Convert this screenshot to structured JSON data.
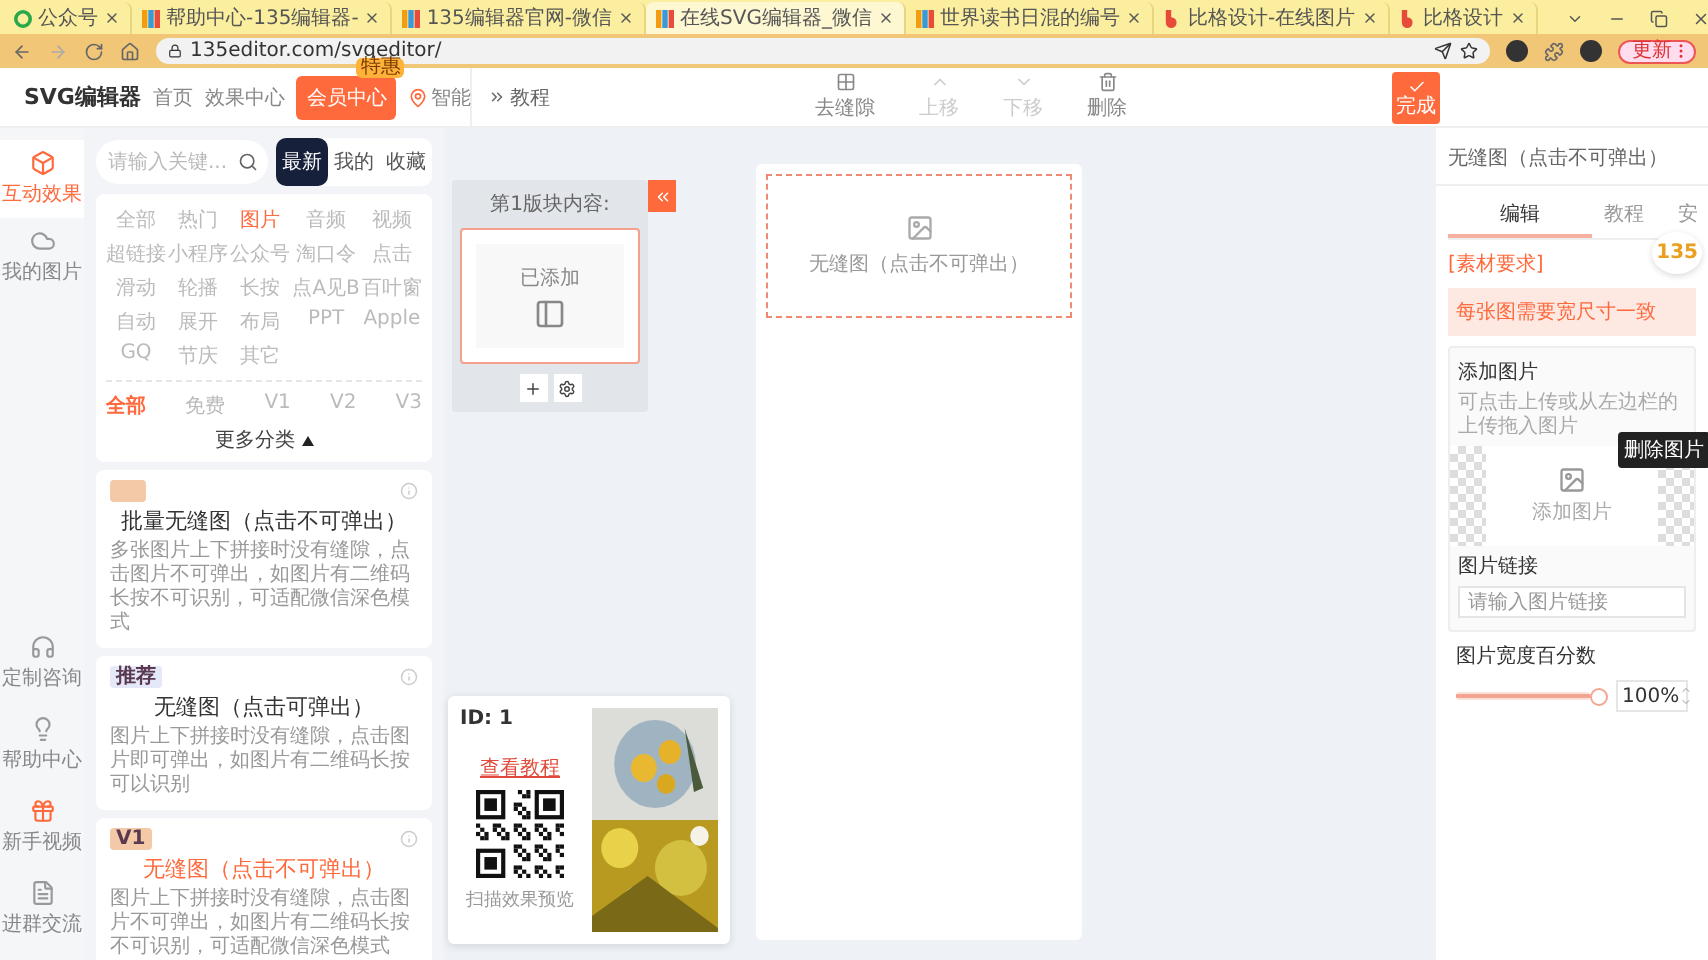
{
  "browser": {
    "tabs": [
      {
        "title": "公众号",
        "kind": "wechat",
        "selected": false
      },
      {
        "title": "帮助中心-135编辑器-",
        "kind": "editor",
        "selected": false
      },
      {
        "title": "135编辑器官网-微信",
        "kind": "editor",
        "selected": false
      },
      {
        "title": "在线SVG编辑器_微信",
        "kind": "editor",
        "selected": true
      },
      {
        "title": "世界读书日混的编号",
        "kind": "editor",
        "selected": false
      },
      {
        "title": "比格设计-在线图片",
        "kind": "bige",
        "selected": false
      },
      {
        "title": "比格设计",
        "kind": "bige",
        "selected": false
      }
    ],
    "url": "135editor.com/svgeditor/",
    "update_button": "更新"
  },
  "header": {
    "logo": "SVG编辑器",
    "nav": [
      {
        "label": "首页",
        "kind": "link"
      },
      {
        "label": "效果中心",
        "kind": "link"
      },
      {
        "label": "会员中心",
        "kind": "vip",
        "badge": "特惠"
      },
      {
        "label": "智能",
        "kind": "pin"
      }
    ],
    "tutorial": "教程",
    "tools": [
      {
        "label": "去缝隙",
        "kind": "grid",
        "disabled": false
      },
      {
        "label": "上移",
        "kind": "up",
        "disabled": true
      },
      {
        "label": "下移",
        "kind": "down",
        "disabled": true
      },
      {
        "label": "删除",
        "kind": "trash",
        "disabled": false
      }
    ],
    "done": "完成"
  },
  "rail": {
    "top": [
      {
        "label": "互动效果",
        "kind": "cube",
        "selected": true
      },
      {
        "label": "我的图片",
        "kind": "cloud",
        "selected": false
      }
    ],
    "bottom": [
      {
        "label": "定制咨询",
        "kind": "headset"
      },
      {
        "label": "帮助中心",
        "kind": "bulb"
      },
      {
        "label": "新手视频",
        "kind": "gift"
      },
      {
        "label": "进群交流",
        "kind": "doc"
      }
    ]
  },
  "library": {
    "search": {
      "placeholder": "请输入关键..."
    },
    "tabs": [
      {
        "label": "最新",
        "selected": true
      },
      {
        "label": "我的",
        "selected": false
      },
      {
        "label": "收藏",
        "selected": false
      }
    ],
    "categories": [
      {
        "label": "全部",
        "selected": false
      },
      {
        "label": "热门",
        "selected": false
      },
      {
        "label": "图片",
        "selected": true
      },
      {
        "label": "音频",
        "selected": false
      },
      {
        "label": "视频",
        "selected": false
      },
      {
        "label": "超链接",
        "selected": false
      },
      {
        "label": "小程序",
        "selected": false
      },
      {
        "label": "公众号",
        "selected": false
      },
      {
        "label": "淘口令",
        "selected": false
      },
      {
        "label": "点击",
        "selected": false
      },
      {
        "label": "滑动",
        "selected": false
      },
      {
        "label": "轮播",
        "selected": false
      },
      {
        "label": "长按",
        "selected": false
      },
      {
        "label": "点A见B",
        "selected": false
      },
      {
        "label": "百叶窗",
        "selected": false
      },
      {
        "label": "自动",
        "selected": false
      },
      {
        "label": "展开",
        "selected": false
      },
      {
        "label": "布局",
        "selected": false
      },
      {
        "label": "PPT",
        "selected": false
      },
      {
        "label": "Apple",
        "selected": false
      },
      {
        "label": "GQ",
        "selected": false
      },
      {
        "label": "节庆",
        "selected": false
      },
      {
        "label": "其它",
        "selected": false
      }
    ],
    "filters": [
      {
        "label": "全部",
        "selected": true
      },
      {
        "label": "免费",
        "selected": false
      },
      {
        "label": "V1",
        "selected": false
      },
      {
        "label": "V2",
        "selected": false
      },
      {
        "label": "V3",
        "selected": false
      }
    ],
    "more": "更多分类",
    "cards": [
      {
        "color": "#f4c9a8",
        "title": "批量无缝图（点击不可弹出）",
        "description": "多张图片上下拼接时没有缝隙，点击图片不可弹出，如图片有二维码长按不可识别，可适配微信深色模式",
        "selected": false
      },
      {
        "color": "#e4e8f8",
        "tag": "推荐",
        "title": "无缝图（点击可弹出）",
        "description": "图片上下拼接时没有缝隙，点击图片即可弹出，如图片有二维码长按可以识别",
        "selected": false
      },
      {
        "color": "#f4c9a8",
        "tag": "V1",
        "title": "无缝图（点击不可弹出）",
        "description": "图片上下拼接时没有缝隙，点击图片不可弹出，如图片有二维码长按不可识别，可适配微信深色模式",
        "selected": true
      }
    ]
  },
  "block_panel": {
    "title": "第1版块内容:",
    "item": "已添加"
  },
  "canvas": {
    "placeholder": "无缝图（点击不可弹出）"
  },
  "preview_popup": {
    "id": "ID: 1",
    "link": "查看教程",
    "qr_caption": "扫描效果预览"
  },
  "properties": {
    "title": "无缝图（点击不可弹出）",
    "tabs": [
      {
        "label": "编辑",
        "selected": true
      },
      {
        "label": "教程",
        "selected": false
      },
      {
        "label": "安",
        "selected": false
      }
    ],
    "floating_logo": "135",
    "requirement_label": "[素材要求]",
    "requirement": "每张图需要宽尺寸一致",
    "upload": {
      "title": "添加图片",
      "hint": "可点击上传或从左边栏的上传拖入图片",
      "button": "添加图片",
      "tooltip": "删除图片"
    },
    "link": {
      "label": "图片链接",
      "placeholder": "请输入图片链接"
    },
    "width": {
      "label": "图片宽度百分数",
      "level": 1,
      "value": "100",
      "unit": "%"
    }
  }
}
